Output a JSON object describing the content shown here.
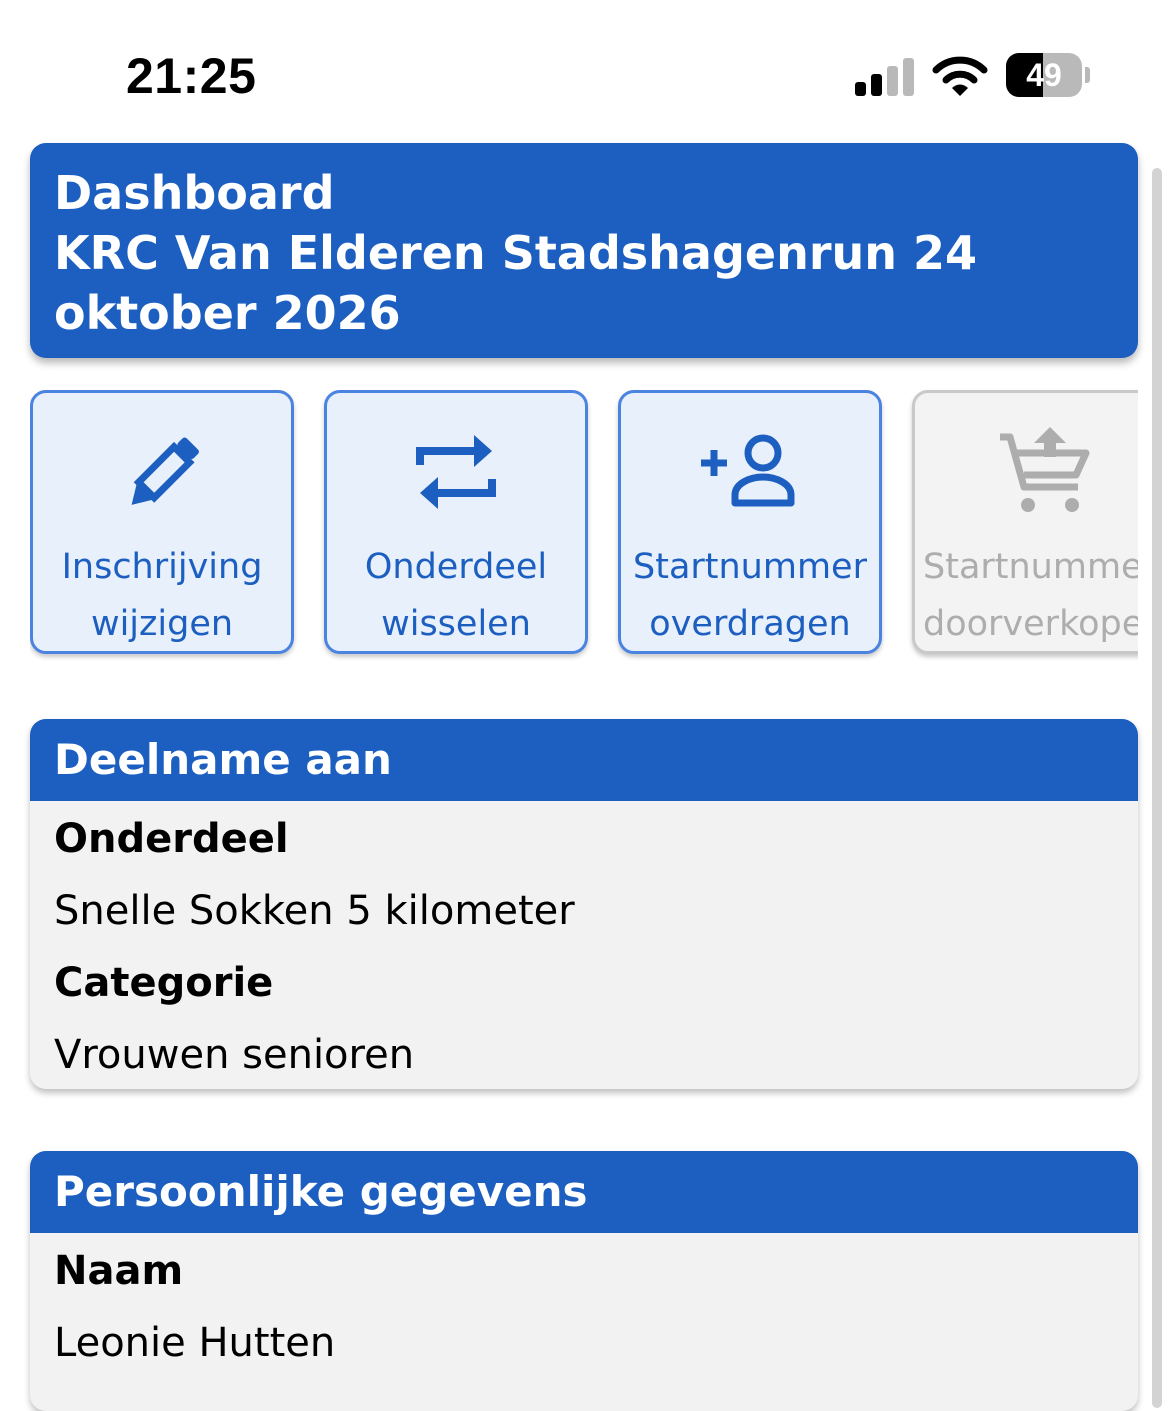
{
  "status_bar": {
    "time": "21:25",
    "battery_level": "49",
    "battery_fraction": 0.49,
    "signal_bars_active": 2,
    "signal_bars_total": 4,
    "icons": [
      "cellular-signal-icon",
      "wifi-icon",
      "battery-icon"
    ]
  },
  "header": {
    "title": "Dashboard",
    "event_name": "KRC Van Elderen Stadshagenrun 24 oktober 2026"
  },
  "actions": [
    {
      "line1": "Inschrijving",
      "line2": "wijzigen",
      "icon": "pencil-icon",
      "enabled": true
    },
    {
      "line1": "Onderdeel",
      "line2": "wisselen",
      "icon": "swap-arrows-icon",
      "enabled": true
    },
    {
      "line1": "Startnummer",
      "line2": "overdragen",
      "icon": "add-person-icon",
      "enabled": true
    },
    {
      "line1": "Startnummer",
      "line2": "doorverkopen",
      "icon": "cart-upload-icon",
      "enabled": false
    }
  ],
  "participation": {
    "heading": "Deelname aan",
    "event_part_label": "Onderdeel",
    "event_part_value": "Snelle Sokken 5 kilometer",
    "category_label": "Categorie",
    "category_value": "Vrouwen senioren"
  },
  "personal": {
    "heading": "Persoonlijke gegevens",
    "name_label": "Naam",
    "name_value": "Leonie Hutten"
  },
  "colors": {
    "primary": "#1c5fc0",
    "primary_light": "#e8f0fc",
    "button_border": "#4a84e0",
    "disabled_text": "#adadad",
    "card_background": "#f2f2f2"
  }
}
